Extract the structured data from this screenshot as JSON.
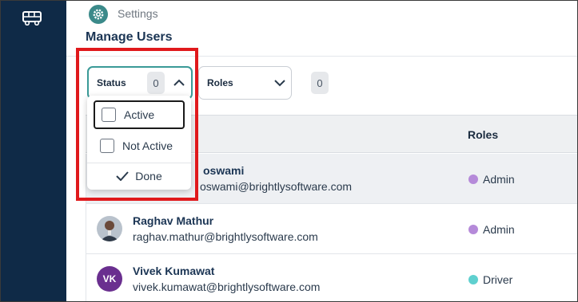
{
  "nav": {
    "rail_icon": "vehicle-icon"
  },
  "header": {
    "breadcrumb": "Settings",
    "breadcrumb_icon": "gear-icon",
    "title": "Manage Users"
  },
  "filters": {
    "status": {
      "label": "Status",
      "count": "0",
      "expanded": true
    },
    "roles": {
      "label": "Roles",
      "count": "0",
      "expanded": false
    }
  },
  "status_dropdown": {
    "options": [
      {
        "label": "Active",
        "checked": false,
        "focused": true
      },
      {
        "label": "Not Active",
        "checked": false,
        "focused": false
      }
    ],
    "done_label": "Done"
  },
  "table": {
    "columns": {
      "roles": "Roles"
    },
    "rows": [
      {
        "name": "Shivangi Goswami",
        "name_visible": "oswami",
        "email": "shivangi.goswami@brightlysoftware.com",
        "email_visible": "oswami@brightlysoftware.com",
        "role": "Admin",
        "role_color": "#b58ad9",
        "avatar": "photo"
      },
      {
        "name": "Raghav Mathur",
        "email": "raghav.mathur@brightlysoftware.com",
        "role": "Admin",
        "role_color": "#b58ad9",
        "avatar": "photo"
      },
      {
        "name": "Vivek Kumawat",
        "email": "vivek.kumawat@brightlysoftware.com",
        "role": "Driver",
        "role_color": "#5fd0cf",
        "avatar": "initials",
        "initials": "VK"
      }
    ]
  },
  "colors": {
    "rail": "#0f2a47",
    "accent": "#3a9a97",
    "highlight": "#e0191c"
  }
}
